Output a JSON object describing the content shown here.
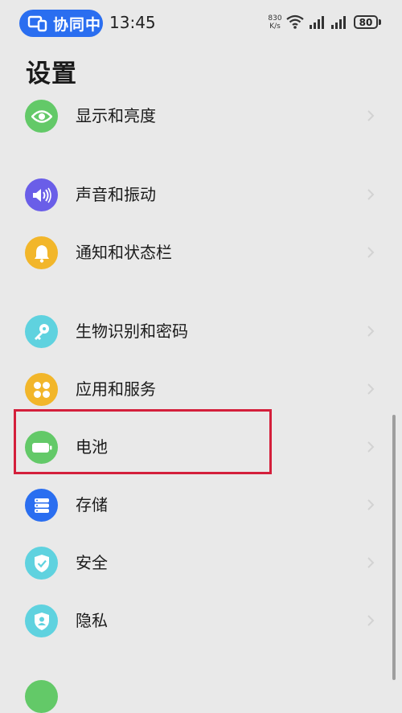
{
  "status_bar": {
    "collab_label": "协同中",
    "time": "13:45",
    "net_speed_value": "830",
    "net_speed_unit": "K/s",
    "battery_level": "80"
  },
  "page": {
    "title": "设置"
  },
  "settings_items": [
    {
      "label": "显示和亮度",
      "icon": "eye-icon",
      "color": "#63c968"
    },
    {
      "label": "声音和振动",
      "icon": "speaker-icon",
      "color": "#6a5ee8"
    },
    {
      "label": "通知和状态栏",
      "icon": "bell-icon",
      "color": "#f2b62a"
    },
    {
      "label": "生物识别和密码",
      "icon": "key-icon",
      "color": "#5fd2df"
    },
    {
      "label": "应用和服务",
      "icon": "apps-grid-icon",
      "color": "#f2b62a"
    },
    {
      "label": "电池",
      "icon": "battery-icon",
      "color": "#63c968"
    },
    {
      "label": "存储",
      "icon": "storage-icon",
      "color": "#2a6ef0"
    },
    {
      "label": "安全",
      "icon": "shield-check-icon",
      "color": "#5fd2df"
    },
    {
      "label": "隐私",
      "icon": "privacy-shield-icon",
      "color": "#5fd2df"
    }
  ]
}
